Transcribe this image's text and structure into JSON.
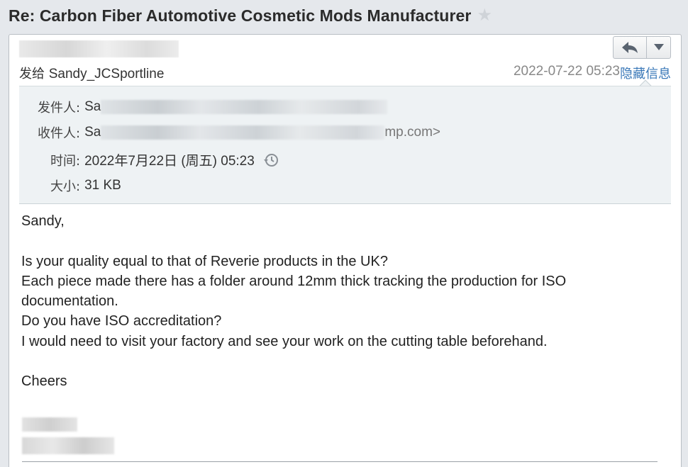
{
  "subject": "Re: Carbon Fiber Automotive Cosmetic Mods Manufacturer",
  "star_icon": "star-icon",
  "sender": {
    "name_redacted": "S",
    "sendto_prefix": "发给",
    "sendto_name": "Sandy_JCSportline",
    "date": "2022-07-22 05:23",
    "hide_info_label": "隐藏信息"
  },
  "toolbar": {
    "reply_icon": "reply-icon",
    "more_icon": "chevron-down-icon"
  },
  "details": {
    "from_label": "发件人:",
    "from_value": "Sa",
    "to_label": "收件人:",
    "to_value": "Sa",
    "to_suffix": "mp.com>",
    "time_label": "时间:",
    "time_value": "2022年7月22日 (周五) 05:23",
    "size_label": "大小:",
    "size_value": "31 KB"
  },
  "message": {
    "greeting": "Sandy,",
    "lines": [
      "Is your quality equal to that of Reverie products in the UK?",
      "Each piece made there has a folder around 12mm thick tracking the production for ISO documentation.",
      "Do you have ISO accreditation?",
      "I would need to visit your factory and see your work on the cutting table beforehand."
    ],
    "signoff": "Cheers"
  },
  "colors": {
    "accent_link": "#3a78b8",
    "details_bg": "#eef2f4",
    "page_bg": "#e5e8ec"
  }
}
